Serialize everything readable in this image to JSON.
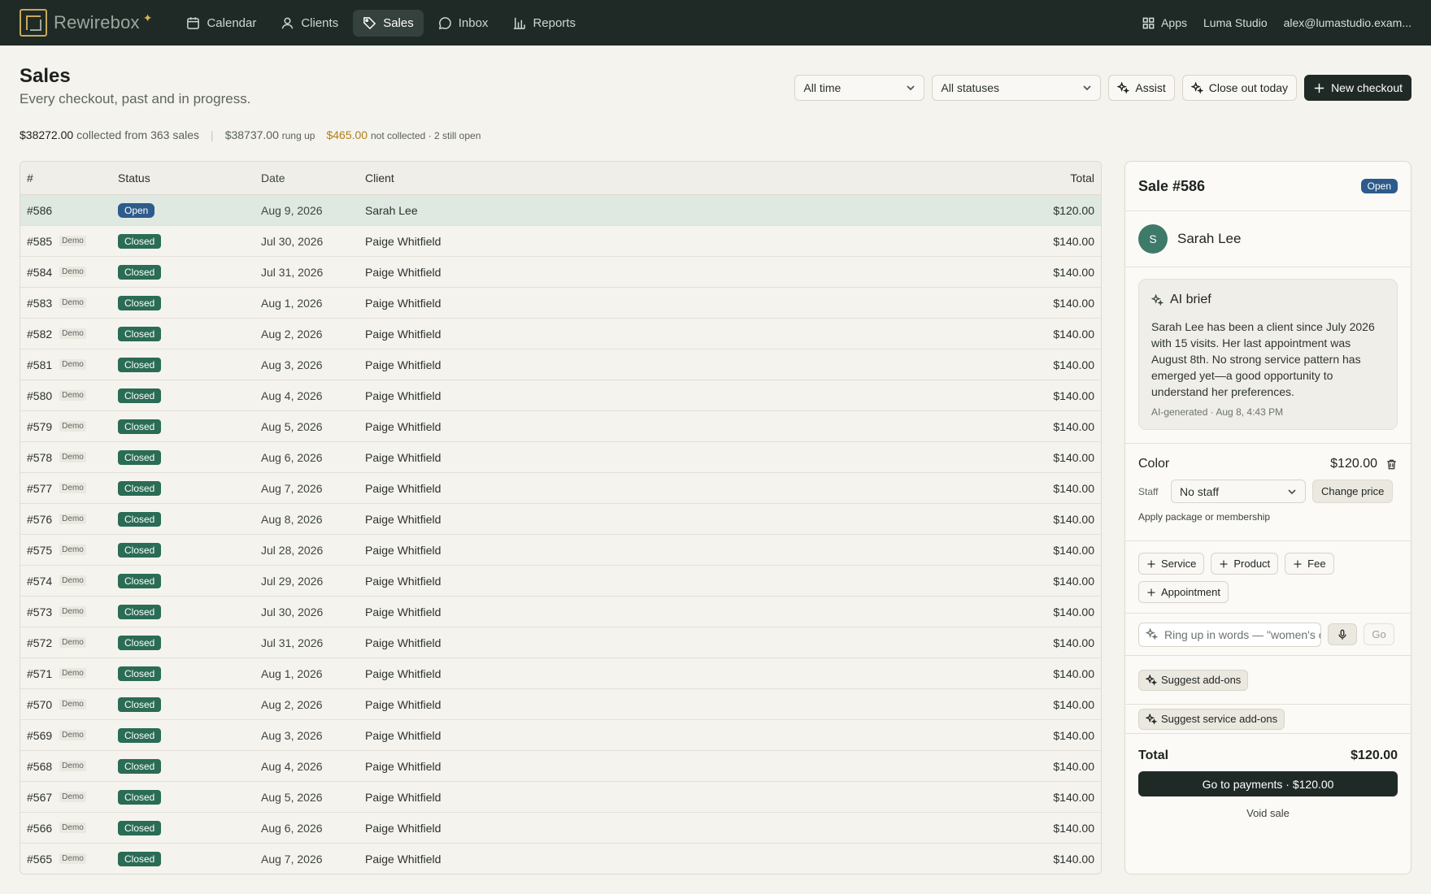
{
  "brand": {
    "name": "Rewirebox",
    "spark": "✦"
  },
  "nav": [
    {
      "label": "Calendar",
      "icon": "calendar-icon"
    },
    {
      "label": "Clients",
      "icon": "user-icon"
    },
    {
      "label": "Sales",
      "icon": "tag-icon",
      "active": true
    },
    {
      "label": "Inbox",
      "icon": "chat-icon"
    },
    {
      "label": "Reports",
      "icon": "bar-chart-icon"
    }
  ],
  "top_right": {
    "apps": "Apps",
    "studio": "Luma Studio",
    "email": "alex@lumastudio.exam..."
  },
  "header": {
    "title": "Sales",
    "subtitle": "Every checkout, past and in progress."
  },
  "summary": {
    "collected": "$38272.00",
    "collected_text": "collected from 363 sales",
    "rung": "$38737.00",
    "rung_text": "rung up",
    "not_collected": "$465.00",
    "not_collected_text": "not collected · 2 still open"
  },
  "controls": {
    "time_filter": "All time",
    "status_filter": "All statuses",
    "assist": "Assist",
    "close_out": "Close out today",
    "new_checkout": "New checkout"
  },
  "table": {
    "columns": {
      "num": "#",
      "status": "Status",
      "date": "Date",
      "client": "Client",
      "total": "Total"
    },
    "rows": [
      {
        "num": "#586",
        "demo": "",
        "status": "Open",
        "date": "Aug 9, 2026",
        "client": "Sarah Lee",
        "total": "$120.00"
      },
      {
        "num": "#585",
        "demo": "Demo",
        "status": "Closed",
        "date": "Jul 30, 2026",
        "client": "Paige Whitfield",
        "total": "$140.00"
      },
      {
        "num": "#584",
        "demo": "Demo",
        "status": "Closed",
        "date": "Jul 31, 2026",
        "client": "Paige Whitfield",
        "total": "$140.00"
      },
      {
        "num": "#583",
        "demo": "Demo",
        "status": "Closed",
        "date": "Aug 1, 2026",
        "client": "Paige Whitfield",
        "total": "$140.00"
      },
      {
        "num": "#582",
        "demo": "Demo",
        "status": "Closed",
        "date": "Aug 2, 2026",
        "client": "Paige Whitfield",
        "total": "$140.00"
      },
      {
        "num": "#581",
        "demo": "Demo",
        "status": "Closed",
        "date": "Aug 3, 2026",
        "client": "Paige Whitfield",
        "total": "$140.00"
      },
      {
        "num": "#580",
        "demo": "Demo",
        "status": "Closed",
        "date": "Aug 4, 2026",
        "client": "Paige Whitfield",
        "total": "$140.00"
      },
      {
        "num": "#579",
        "demo": "Demo",
        "status": "Closed",
        "date": "Aug 5, 2026",
        "client": "Paige Whitfield",
        "total": "$140.00"
      },
      {
        "num": "#578",
        "demo": "Demo",
        "status": "Closed",
        "date": "Aug 6, 2026",
        "client": "Paige Whitfield",
        "total": "$140.00"
      },
      {
        "num": "#577",
        "demo": "Demo",
        "status": "Closed",
        "date": "Aug 7, 2026",
        "client": "Paige Whitfield",
        "total": "$140.00"
      },
      {
        "num": "#576",
        "demo": "Demo",
        "status": "Closed",
        "date": "Aug 8, 2026",
        "client": "Paige Whitfield",
        "total": "$140.00"
      },
      {
        "num": "#575",
        "demo": "Demo",
        "status": "Closed",
        "date": "Jul 28, 2026",
        "client": "Paige Whitfield",
        "total": "$140.00"
      },
      {
        "num": "#574",
        "demo": "Demo",
        "status": "Closed",
        "date": "Jul 29, 2026",
        "client": "Paige Whitfield",
        "total": "$140.00"
      },
      {
        "num": "#573",
        "demo": "Demo",
        "status": "Closed",
        "date": "Jul 30, 2026",
        "client": "Paige Whitfield",
        "total": "$140.00"
      },
      {
        "num": "#572",
        "demo": "Demo",
        "status": "Closed",
        "date": "Jul 31, 2026",
        "client": "Paige Whitfield",
        "total": "$140.00"
      },
      {
        "num": "#571",
        "demo": "Demo",
        "status": "Closed",
        "date": "Aug 1, 2026",
        "client": "Paige Whitfield",
        "total": "$140.00"
      },
      {
        "num": "#570",
        "demo": "Demo",
        "status": "Closed",
        "date": "Aug 2, 2026",
        "client": "Paige Whitfield",
        "total": "$140.00"
      },
      {
        "num": "#569",
        "demo": "Demo",
        "status": "Closed",
        "date": "Aug 3, 2026",
        "client": "Paige Whitfield",
        "total": "$140.00"
      },
      {
        "num": "#568",
        "demo": "Demo",
        "status": "Closed",
        "date": "Aug 4, 2026",
        "client": "Paige Whitfield",
        "total": "$140.00"
      },
      {
        "num": "#567",
        "demo": "Demo",
        "status": "Closed",
        "date": "Aug 5, 2026",
        "client": "Paige Whitfield",
        "total": "$140.00"
      },
      {
        "num": "#566",
        "demo": "Demo",
        "status": "Closed",
        "date": "Aug 6, 2026",
        "client": "Paige Whitfield",
        "total": "$140.00"
      },
      {
        "num": "#565",
        "demo": "Demo",
        "status": "Closed",
        "date": "Aug 7, 2026",
        "client": "Paige Whitfield",
        "total": "$140.00"
      }
    ]
  },
  "panel": {
    "title": "Sale #586",
    "status": "Open",
    "client_initial": "S",
    "client_name": "Sarah Lee",
    "brief_title": "AI brief",
    "brief_text": "Sarah Lee has been a client since July 2026 with 15 visits. Her last appointment was August 8th. No strong service pattern has emerged yet—a good opportunity to understand her preferences.",
    "brief_meta": "AI-generated · Aug 8, 4:43 PM",
    "line_name": "Color",
    "line_price": "$120.00",
    "staff_label": "Staff",
    "staff_value": "No staff",
    "change_price": "Change price",
    "apply_link": "Apply package or membership",
    "add_buttons": [
      "Service",
      "Product",
      "Fee",
      "Appointment"
    ],
    "ring_placeholder": "Ring up in words — \"women's cut and color\"",
    "go": "Go",
    "suggest_addons": "Suggest add-ons",
    "suggest_service_addons": "Suggest service add-ons",
    "total_label": "Total",
    "total_value": "$120.00",
    "pay_button": "Go to payments · $120.00",
    "void": "Void sale"
  },
  "colors": {
    "nav_bg": "#1f2a26",
    "closed": "#2a6c55",
    "open": "#2d5b8b",
    "warn": "#b07f1a"
  }
}
